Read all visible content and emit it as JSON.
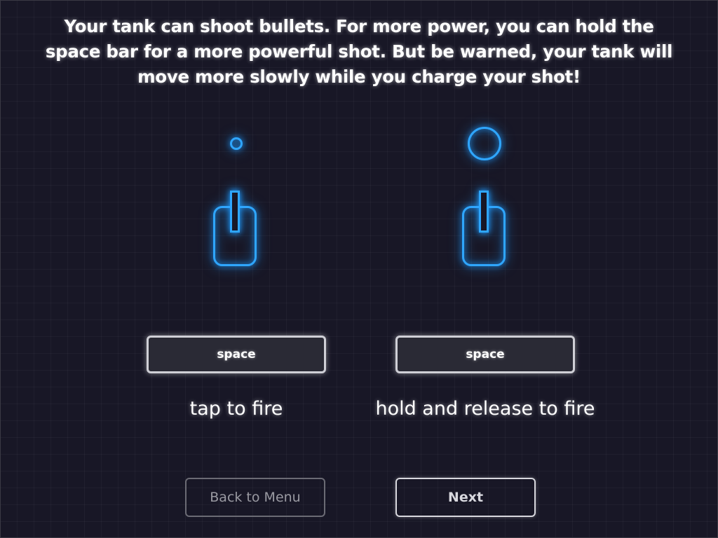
{
  "instructions": {
    "text": "Your tank can shoot bullets. For more power, you can hold the space bar for a more powerful shot. But be warned, your tank will move more slowly while you charge your shot!"
  },
  "demo_left": {
    "key_label": "space",
    "caption": "tap to fire",
    "bullet": "small-bullet-icon",
    "tank": "tank-icon"
  },
  "demo_right": {
    "key_label": "space",
    "caption": "hold and release to fire",
    "bullet": "large-bullet-icon",
    "tank": "tank-icon"
  },
  "buttons": {
    "back_label": "Back to Menu",
    "next_label": "Next"
  },
  "colors": {
    "background": "#181726",
    "glow_blue": "#2fa6ff",
    "text": "#ffffff"
  }
}
